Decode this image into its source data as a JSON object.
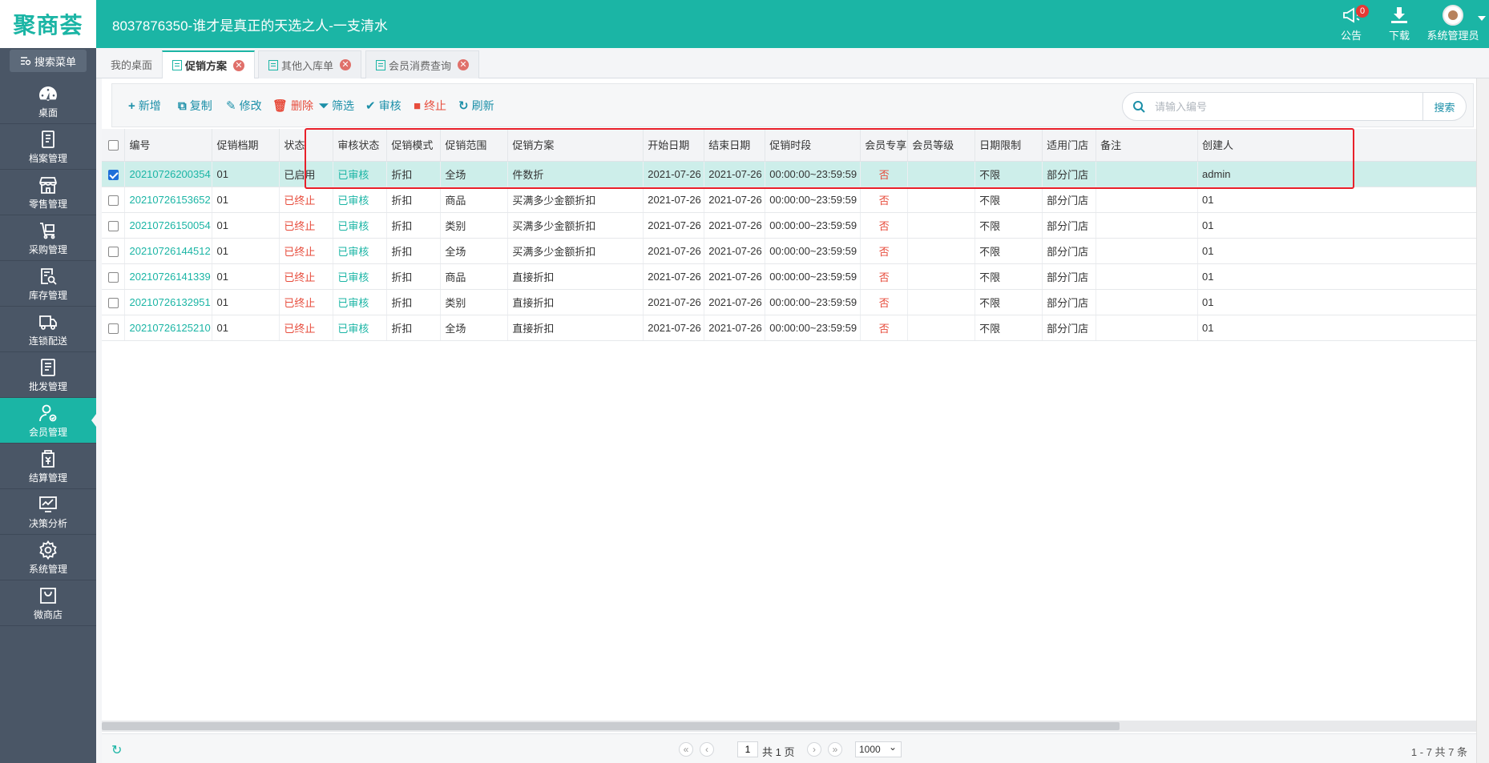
{
  "header": {
    "logo": "聚商荟",
    "store_title": "8037876350-谁才是真正的天选之人-一支清水",
    "announce_label": "公告",
    "announce_count": "0",
    "download_label": "下载",
    "user_label": "系统管理员"
  },
  "sidebar": {
    "search_menu": "搜索菜单",
    "items": [
      {
        "label": "桌面",
        "icon": "dashboard-icon"
      },
      {
        "label": "档案管理",
        "icon": "archive-icon"
      },
      {
        "label": "零售管理",
        "icon": "store-icon"
      },
      {
        "label": "采购管理",
        "icon": "cart-icon"
      },
      {
        "label": "库存管理",
        "icon": "inventory-icon"
      },
      {
        "label": "连锁配送",
        "icon": "truck-icon"
      },
      {
        "label": "批发管理",
        "icon": "wholesale-icon"
      },
      {
        "label": "会员管理",
        "icon": "member-icon"
      },
      {
        "label": "结算管理",
        "icon": "settlement-icon"
      },
      {
        "label": "决策分析",
        "icon": "analysis-icon"
      },
      {
        "label": "系统管理",
        "icon": "gear-icon"
      },
      {
        "label": "微商店",
        "icon": "shop-bag-icon"
      }
    ]
  },
  "tabs": [
    {
      "label": "我的桌面"
    },
    {
      "label": "促销方案"
    },
    {
      "label": "其他入库单"
    },
    {
      "label": "会员消费查询"
    }
  ],
  "toolbar": {
    "add": "新增",
    "copy": "复制",
    "edit": "修改",
    "delete": "删除",
    "filter": "筛选",
    "audit": "审核",
    "stop": "终止",
    "refresh": "刷新",
    "search_placeholder": "请输入编号",
    "search_button": "搜索"
  },
  "table": {
    "columns": [
      "编号",
      "促销档期",
      "状态",
      "审核状态",
      "促销模式",
      "促销范围",
      "促销方案",
      "开始日期",
      "结束日期",
      "促销时段",
      "会员专享",
      "会员等级",
      "日期限制",
      "适用门店",
      "备注",
      "创建人"
    ],
    "rows": [
      [
        "20210726200354",
        "01",
        "已启用",
        "已审核",
        "折扣",
        "全场",
        "件数折",
        "2021-07-26",
        "2021-07-26",
        "00:00:00~23:59:59",
        "否",
        "",
        "不限",
        "部分门店",
        "",
        "admin"
      ],
      [
        "20210726153652",
        "01",
        "已终止",
        "已审核",
        "折扣",
        "商品",
        "买满多少金额折扣",
        "2021-07-26",
        "2021-07-26",
        "00:00:00~23:59:59",
        "否",
        "",
        "不限",
        "部分门店",
        "",
        "01"
      ],
      [
        "20210726150054",
        "01",
        "已终止",
        "已审核",
        "折扣",
        "类别",
        "买满多少金额折扣",
        "2021-07-26",
        "2021-07-26",
        "00:00:00~23:59:59",
        "否",
        "",
        "不限",
        "部分门店",
        "",
        "01"
      ],
      [
        "20210726144512",
        "01",
        "已终止",
        "已审核",
        "折扣",
        "全场",
        "买满多少金额折扣",
        "2021-07-26",
        "2021-07-26",
        "00:00:00~23:59:59",
        "否",
        "",
        "不限",
        "部分门店",
        "",
        "01"
      ],
      [
        "20210726141339",
        "01",
        "已终止",
        "已审核",
        "折扣",
        "商品",
        "直接折扣",
        "2021-07-26",
        "2021-07-26",
        "00:00:00~23:59:59",
        "否",
        "",
        "不限",
        "部分门店",
        "",
        "01"
      ],
      [
        "20210726132951",
        "01",
        "已终止",
        "已审核",
        "折扣",
        "类别",
        "直接折扣",
        "2021-07-26",
        "2021-07-26",
        "00:00:00~23:59:59",
        "否",
        "",
        "不限",
        "部分门店",
        "",
        "01"
      ],
      [
        "20210726125210",
        "01",
        "已终止",
        "已审核",
        "折扣",
        "全场",
        "直接折扣",
        "2021-07-26",
        "2021-07-26",
        "00:00:00~23:59:59",
        "否",
        "",
        "不限",
        "部分门店",
        "",
        "01"
      ]
    ]
  },
  "pager": {
    "current_page": "1",
    "total_pages": "共 1 页",
    "page_size": "1000",
    "info": "1 - 7    共 7 条"
  },
  "colors": {
    "brand": "#1bb5a5",
    "sidebar": "#4a5666",
    "danger": "#e74c3c",
    "highlight_border": "#e8202a"
  }
}
